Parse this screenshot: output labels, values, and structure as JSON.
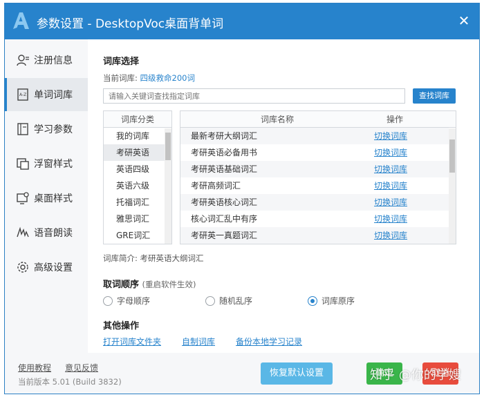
{
  "window": {
    "title": "参数设置 - DesktopVoc桌面背单词",
    "close_icon": "close-icon",
    "accent_color": "#2783cc"
  },
  "sidebar": {
    "items": [
      {
        "label": "注册信息",
        "icon": "user-icon",
        "active": false
      },
      {
        "label": "单词词库",
        "icon": "dictionary-icon",
        "active": true
      },
      {
        "label": "学习参数",
        "icon": "book-icon",
        "active": false
      },
      {
        "label": "浮窗样式",
        "icon": "floating-window-icon",
        "active": false
      },
      {
        "label": "桌面样式",
        "icon": "desktop-icon",
        "active": false
      },
      {
        "label": "语音朗读",
        "icon": "voice-icon",
        "active": false
      },
      {
        "label": "高级设置",
        "icon": "gear-icon",
        "active": false
      }
    ]
  },
  "library": {
    "section_title": "词库选择",
    "current_label": "当前词库:",
    "current_value": "四级救命200词",
    "search_placeholder": "请输入关键词查找指定词库",
    "search_button": "查找词库",
    "category_header": "词库分类",
    "categories": [
      "我的词库",
      "考研英语",
      "英语四级",
      "英语六级",
      "托福词汇",
      "雅思词汇",
      "GRE词汇"
    ],
    "active_category": "考研英语",
    "table_headers": {
      "name": "词库名称",
      "operation": "操作"
    },
    "rows": [
      {
        "name": "最新考研大纲词汇",
        "action": "切换词库"
      },
      {
        "name": "考研英语必备用书",
        "action": "切换词库"
      },
      {
        "name": "考研英语基础词汇",
        "action": "切换词库"
      },
      {
        "name": "考研高频词汇",
        "action": "切换词库"
      },
      {
        "name": "考研英语核心词汇",
        "action": "切换词库"
      },
      {
        "name": "核心词汇乱中有序",
        "action": "切换词库"
      },
      {
        "name": "考研英一真题词汇",
        "action": "切换词库"
      }
    ],
    "intro": "词库简介:  考研英语大纲词汇"
  },
  "order": {
    "title": "取词顺序",
    "note": "(重启软件生效)",
    "options": [
      {
        "label": "字母顺序",
        "checked": false
      },
      {
        "label": "随机乱序",
        "checked": false
      },
      {
        "label": "词库原序",
        "checked": true
      }
    ]
  },
  "other": {
    "title": "其他操作",
    "links": [
      "打开词库文件夹",
      "自制词库",
      "备份本地学习记录"
    ]
  },
  "footer": {
    "tutorial": "使用教程",
    "feedback": "意见反馈",
    "version": "当前版本 5.01 (Build 3832)",
    "restore": "恢复默认设置",
    "ok": "确定",
    "cancel": "取消",
    "watermark": "知乎 @你的学嫂"
  }
}
